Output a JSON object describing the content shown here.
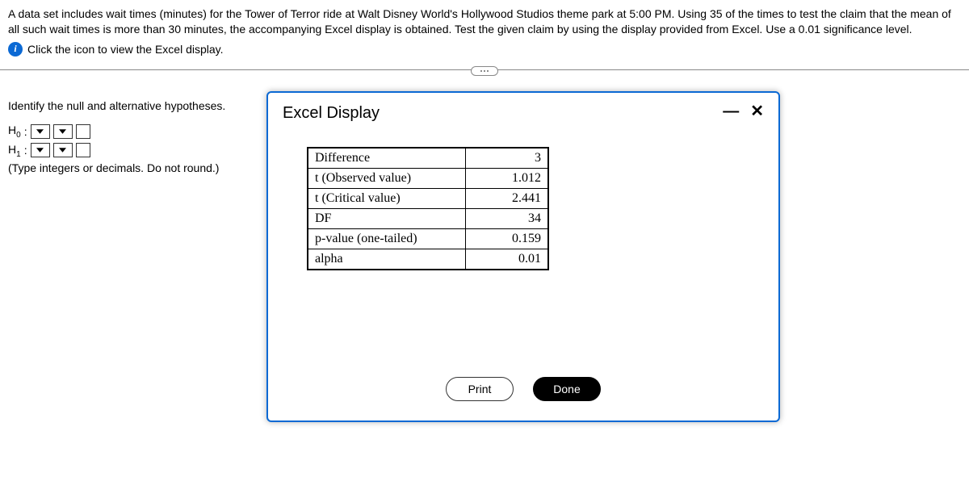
{
  "problem_text": "A data set includes wait times (minutes) for the Tower of Terror ride at Walt Disney World's Hollywood Studios theme park at 5:00 PM. Using 35 of the times to test the claim that the mean of all such wait times is more than 30 minutes, the accompanying Excel display is obtained. Test the given claim by using the display provided from Excel. Use a 0.01 significance level.",
  "info_icon_label": "i",
  "info_row_text": "Click the icon to view the Excel display.",
  "prompt": "Identify the null and alternative hypotheses.",
  "h0_label": "H",
  "h0_sub": "0",
  "h1_label": "H",
  "h1_sub": "1",
  "colon": ":",
  "note": "(Type integers or decimals. Do not round.)",
  "dialog": {
    "title": "Excel Display",
    "minimize": "—",
    "close": "✕",
    "print": "Print",
    "done": "Done"
  },
  "excel_rows": [
    {
      "label": "Difference",
      "value": "3"
    },
    {
      "label": "t (Observed value)",
      "value": "1.012"
    },
    {
      "label": "t (Critical value)",
      "value": "2.441"
    },
    {
      "label": "DF",
      "value": "34"
    },
    {
      "label": "p-value (one-tailed)",
      "value": "0.159"
    },
    {
      "label": "alpha",
      "value": "0.01"
    }
  ]
}
